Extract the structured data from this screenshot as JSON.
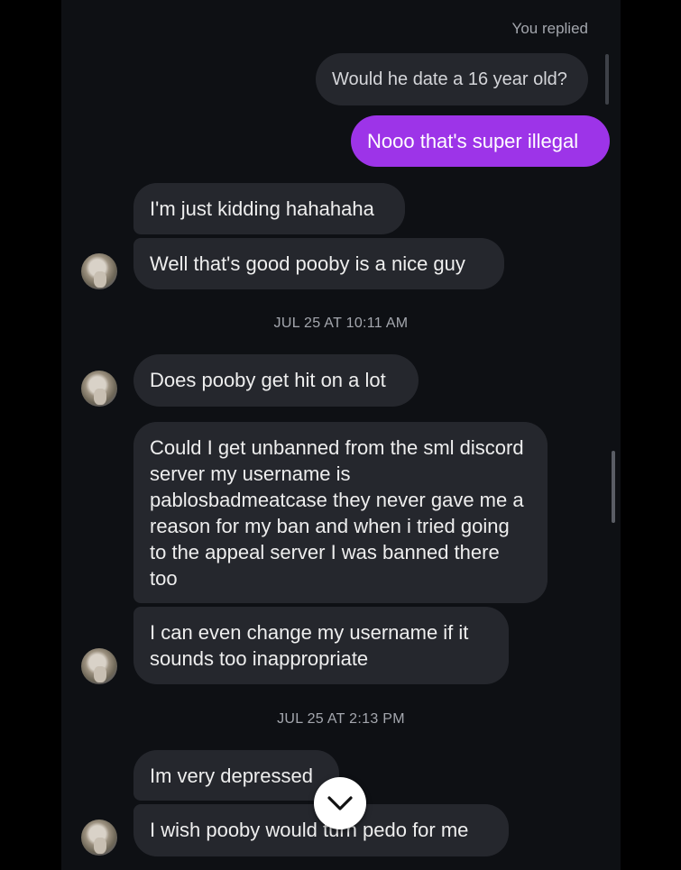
{
  "thread": {
    "reply_label": "You replied",
    "quoted_message": "Would he date a 16 year old?",
    "my_message": "Nooo that's super illegal",
    "messages": [
      "I'm just kidding hahahaha",
      "Well that's good pooby is a nice guy",
      "Does pooby get hit on a lot",
      "Could I get unbanned from the sml discord server my username is pablosbadmeatcase they never gave me a reason for my ban and when i tried going to the appeal server I was banned there too",
      "I can even change my username if it sounds too inappropriate",
      "Im very depressed",
      "I wish pooby would turn pedo for me"
    ],
    "timestamps": [
      "JUL 25 AT 10:11 AM",
      "JUL 25 AT 2:13 PM"
    ]
  },
  "icons": {
    "avatar": "contact-avatar",
    "jump_button": "chevron-down-icon"
  },
  "colors": {
    "background": "#0e1014",
    "incoming_bubble": "#25272d",
    "outgoing_bubble": "#9d34e8",
    "timestamp_text": "#a4a7ae"
  }
}
